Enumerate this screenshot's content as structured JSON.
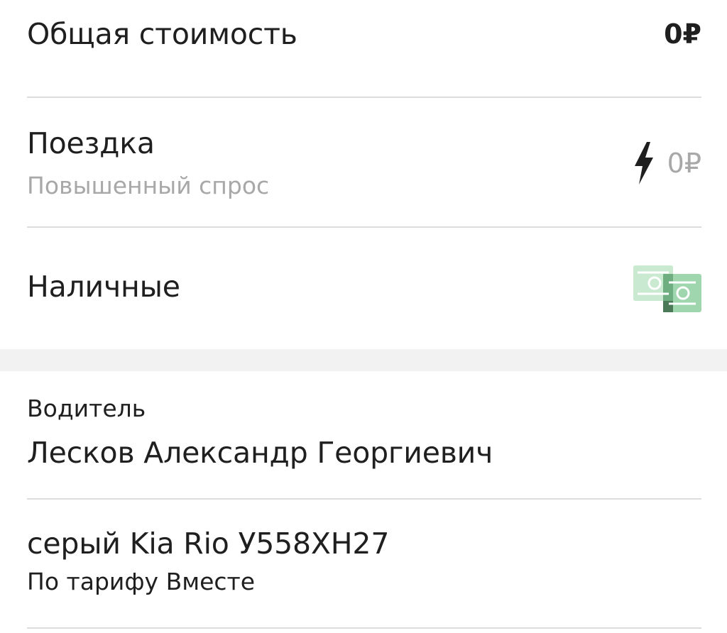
{
  "total": {
    "label": "Общая стоимость",
    "amount": "0₽"
  },
  "ride": {
    "label": "Поездка",
    "note": "Повышенный спрос",
    "amount": "0₽",
    "icon": "lightning-icon"
  },
  "payment": {
    "label": "Наличные",
    "icon": "cash-icon",
    "icon_color": "#9fd6ae"
  },
  "driver": {
    "label": "Водитель",
    "name": "Лесков Александр Георгиевич"
  },
  "car": {
    "description": "серый Kia Rio У558ХН27",
    "tariff": "По тарифу Вместе"
  }
}
